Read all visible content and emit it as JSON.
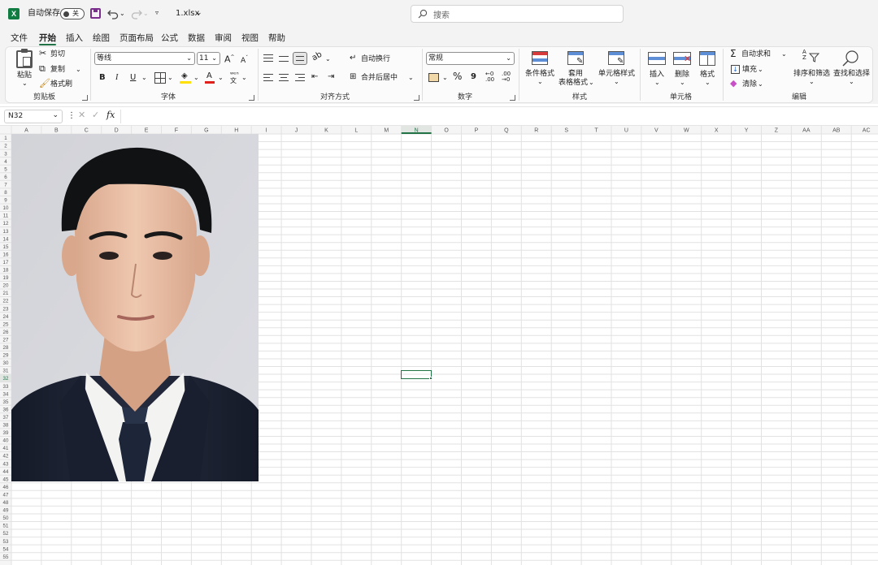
{
  "titlebar": {
    "autosave_label": "自动保存",
    "autosave_state": "关",
    "filename": "1.xlsx",
    "search_placeholder": "搜索"
  },
  "tabs": [
    "文件",
    "开始",
    "插入",
    "绘图",
    "页面布局",
    "公式",
    "数据",
    "审阅",
    "视图",
    "帮助"
  ],
  "active_tab": "开始",
  "ribbon": {
    "clipboard": {
      "paste": "粘贴",
      "cut": "剪切",
      "copy": "复制",
      "format_painter": "格式刷",
      "group": "剪贴板"
    },
    "font": {
      "name": "等线",
      "size": "11",
      "bold": "B",
      "italic": "I",
      "underline": "U",
      "group": "字体"
    },
    "alignment": {
      "wrap": "自动换行",
      "merge": "合并后居中",
      "group": "对齐方式"
    },
    "number": {
      "format": "常规",
      "percent": "%",
      "comma": "9",
      "group": "数字"
    },
    "styles": {
      "conditional": "条件格式",
      "table_line1": "套用",
      "table_line2": "表格格式",
      "cell_styles": "单元格样式",
      "group": "样式"
    },
    "cells": {
      "insert": "插入",
      "delete": "删除",
      "format": "格式",
      "group": "单元格"
    },
    "editing": {
      "autosum": "自动求和",
      "fill": "填充",
      "clear": "清除",
      "sort_filter": "排序和筛选",
      "find_select": "查找和选择",
      "group": "编辑"
    }
  },
  "formula_bar": {
    "name_box": "N32",
    "fx": "fx",
    "value": ""
  },
  "grid": {
    "columns": [
      "A",
      "B",
      "C",
      "D",
      "E",
      "F",
      "G",
      "H",
      "I",
      "J",
      "K",
      "L",
      "M",
      "N",
      "O",
      "P",
      "Q",
      "R",
      "S",
      "T",
      "U",
      "V",
      "W",
      "X",
      "Y",
      "Z",
      "AA",
      "AB",
      "AC"
    ],
    "row_count": 55,
    "selected_col": "N",
    "selected_row": 32
  },
  "colors": {
    "accent": "#217346",
    "chrome": "#f3f3f3",
    "grid_line": "#e2e2e2",
    "header_bg": "#f5f5f5",
    "suit": "#1f2536",
    "tie": "#1d2638",
    "photo_bg": "#d6d7dc"
  }
}
